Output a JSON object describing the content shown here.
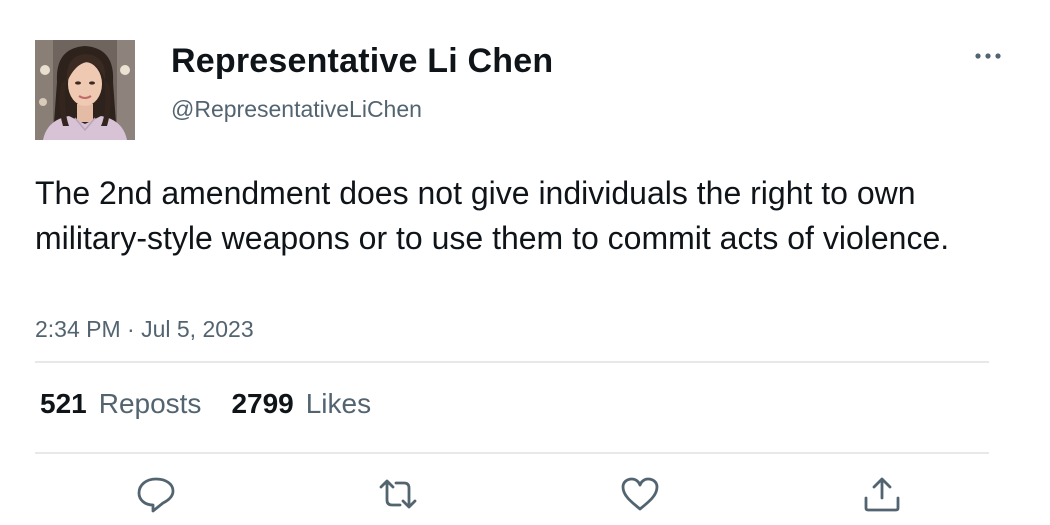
{
  "author": {
    "display_name": "Representative Li Chen",
    "handle": "@RepresentativeLiChen",
    "avatar_icon": "profile-photo"
  },
  "tweet": {
    "text": "The 2nd amendment does not give individuals the right to own military-style weapons or to use them to commit acts of violence.",
    "timestamp": "2:34 PM · Jul 5, 2023"
  },
  "stats": {
    "reposts_count": "521",
    "reposts_label": "Reposts",
    "likes_count": "2799",
    "likes_label": "Likes"
  },
  "actions": [
    {
      "name": "reply",
      "icon": "reply-icon"
    },
    {
      "name": "repost",
      "icon": "repost-icon"
    },
    {
      "name": "like",
      "icon": "heart-icon"
    },
    {
      "name": "share",
      "icon": "share-icon"
    }
  ],
  "menu": {
    "icon": "more-icon"
  },
  "colors": {
    "text": "#0f1419",
    "secondary": "#536471",
    "divider": "#e6e8ea",
    "background": "#ffffff"
  }
}
